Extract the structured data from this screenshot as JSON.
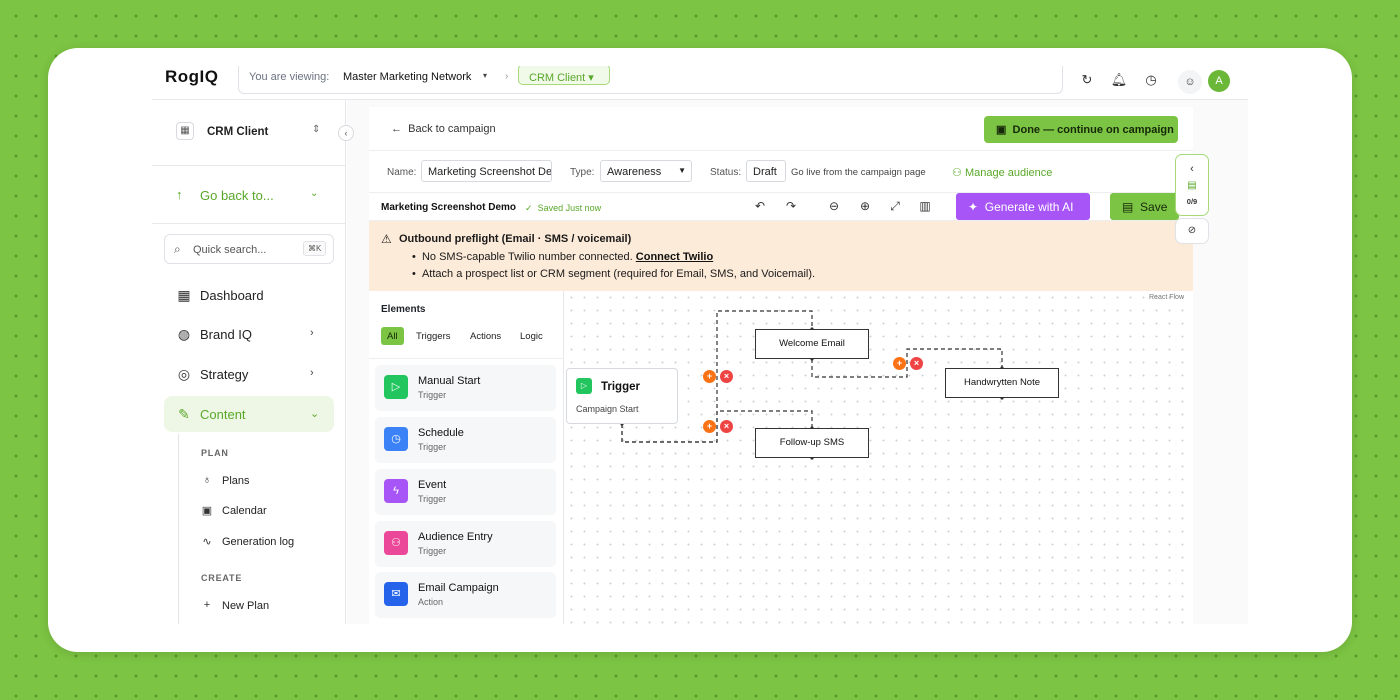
{
  "topbar": {
    "logo": "RogIQ",
    "viewing_label": "You are viewing:",
    "network": "Master Marketing Network",
    "network_chev": "▾",
    "separator": "›",
    "client": "CRM Client",
    "client_chev": "▾",
    "icons": [
      "history-icon",
      "bell-icon",
      "help-icon",
      "ghost-icon"
    ],
    "avatar_initial": "A"
  },
  "sidebar": {
    "org_name": "CRM Client",
    "go_back": "Go back to...",
    "search_placeholder": "Quick search...",
    "search_kbd": "⌘K",
    "nav": [
      {
        "label": "Dashboard"
      },
      {
        "label": "Brand IQ"
      },
      {
        "label": "Strategy"
      },
      {
        "label": "Content"
      }
    ],
    "plan_heading": "PLAN",
    "plan_items": [
      {
        "label": "Plans"
      },
      {
        "label": "Calendar"
      },
      {
        "label": "Generation log"
      }
    ],
    "create_heading": "CREATE",
    "create_items": [
      {
        "label": "New Plan"
      }
    ]
  },
  "editor": {
    "back": "Back to campaign",
    "done": "Done — continue on campaign",
    "name_label": "Name:",
    "name_value": "Marketing Screenshot Demo",
    "type_label": "Type:",
    "type_value": "Awareness",
    "status_label": "Status:",
    "status_value": "Draft",
    "status_note": "Go live from the campaign page",
    "manage_audience": "Manage audience",
    "title": "Marketing Screenshot Demo",
    "saved": "Saved Just now",
    "generate": "Generate with AI",
    "save": "Save",
    "right_rail_count": "0/9"
  },
  "preflight": {
    "heading": "Outbound preflight (Email · SMS / voicemail)",
    "line1": "No SMS-capable Twilio number connected.",
    "line1_link": "Connect Twilio",
    "line2": "Attach a prospect list or CRM segment (required for Email, SMS, and Voicemail)."
  },
  "elements": {
    "heading": "Elements",
    "tabs": [
      {
        "label": "All"
      },
      {
        "label": "Triggers"
      },
      {
        "label": "Actions"
      },
      {
        "label": "Logic"
      }
    ],
    "items": [
      {
        "name": "Manual Start",
        "kind": "Trigger",
        "color": "#22c55e",
        "icon": "play-icon"
      },
      {
        "name": "Schedule",
        "kind": "Trigger",
        "color": "#3b82f6",
        "icon": "clock-icon"
      },
      {
        "name": "Event",
        "kind": "Trigger",
        "color": "#a855f7",
        "icon": "zap-icon"
      },
      {
        "name": "Audience Entry",
        "kind": "Trigger",
        "color": "#ec4899",
        "icon": "users-icon"
      },
      {
        "name": "Email Campaign",
        "kind": "Action",
        "color": "#2563eb",
        "icon": "mail-icon"
      }
    ]
  },
  "flow": {
    "watermark": "React Flow",
    "trigger_title": "Trigger",
    "trigger_sub": "Campaign Start",
    "nodes": [
      {
        "label": "Welcome Email"
      },
      {
        "label": "Handwrytten Note"
      },
      {
        "label": "Follow-up SMS"
      }
    ]
  },
  "colors": {
    "accent": "#7cc443",
    "accent_text": "#5aa82a",
    "ai": "#a855f7",
    "warning_bg": "#fdebd9"
  }
}
